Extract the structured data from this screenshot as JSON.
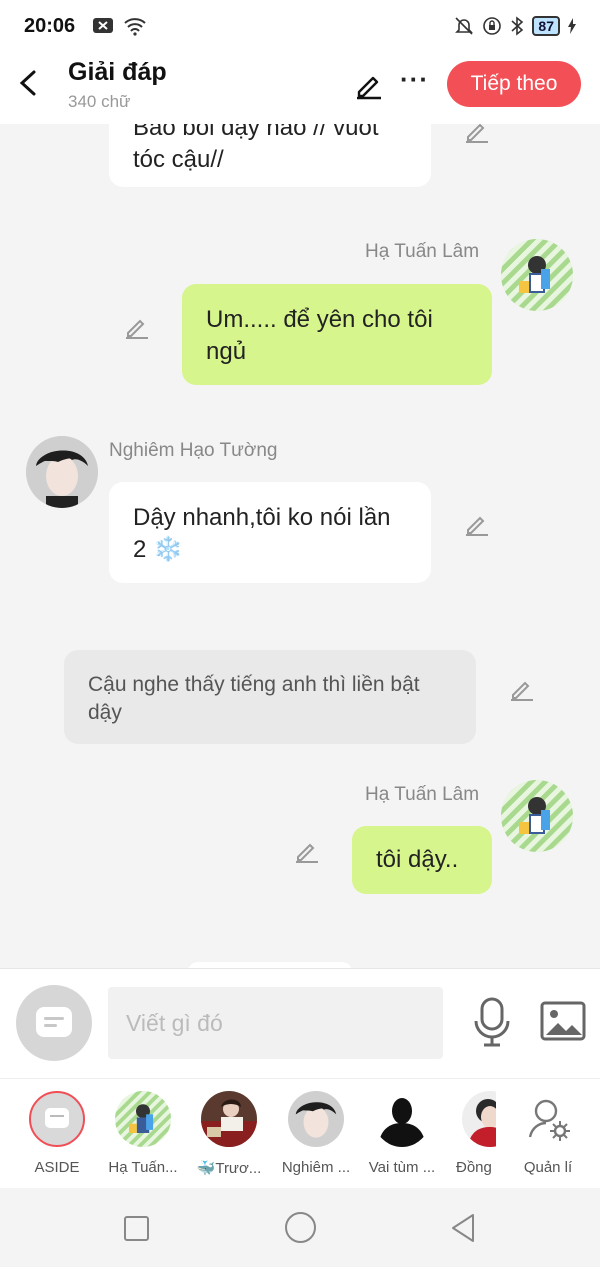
{
  "status": {
    "time": "20:06",
    "battery": "87"
  },
  "header": {
    "title": "Giải đáp",
    "subtitle": "340 chữ",
    "next_label": "Tiếp theo"
  },
  "messages": {
    "m0": {
      "text": "Bảo bối dậy nào // vuốt tóc cậu//"
    },
    "m1": {
      "sender": "Hạ Tuấn Lâm",
      "text": "Um..... để yên cho tôi ngủ"
    },
    "m2": {
      "sender": "Nghiêm Hạo Tường",
      "text": "Dậy nhanh,tôi ko nói lần 2 ❄️"
    },
    "m3": {
      "text": "Cậu nghe thấy tiếng anh thì liền bật dậy"
    },
    "m4": {
      "sender": "Hạ Tuấn Lâm",
      "text": "tôi dậy.."
    }
  },
  "composer": {
    "placeholder": "Viết gì đó"
  },
  "characters": [
    {
      "label": "ASIDE"
    },
    {
      "label": "Hạ Tuấn..."
    },
    {
      "label": "🐳Trươ..."
    },
    {
      "label": "Nghiêm ..."
    },
    {
      "label": "Vai tùm ..."
    },
    {
      "label": "Đồng"
    },
    {
      "label": "Quản lí"
    }
  ],
  "colors": {
    "accent": "#f25056",
    "bubble_green": "#d6f58c",
    "bubble_gray": "#e9e9e9"
  }
}
